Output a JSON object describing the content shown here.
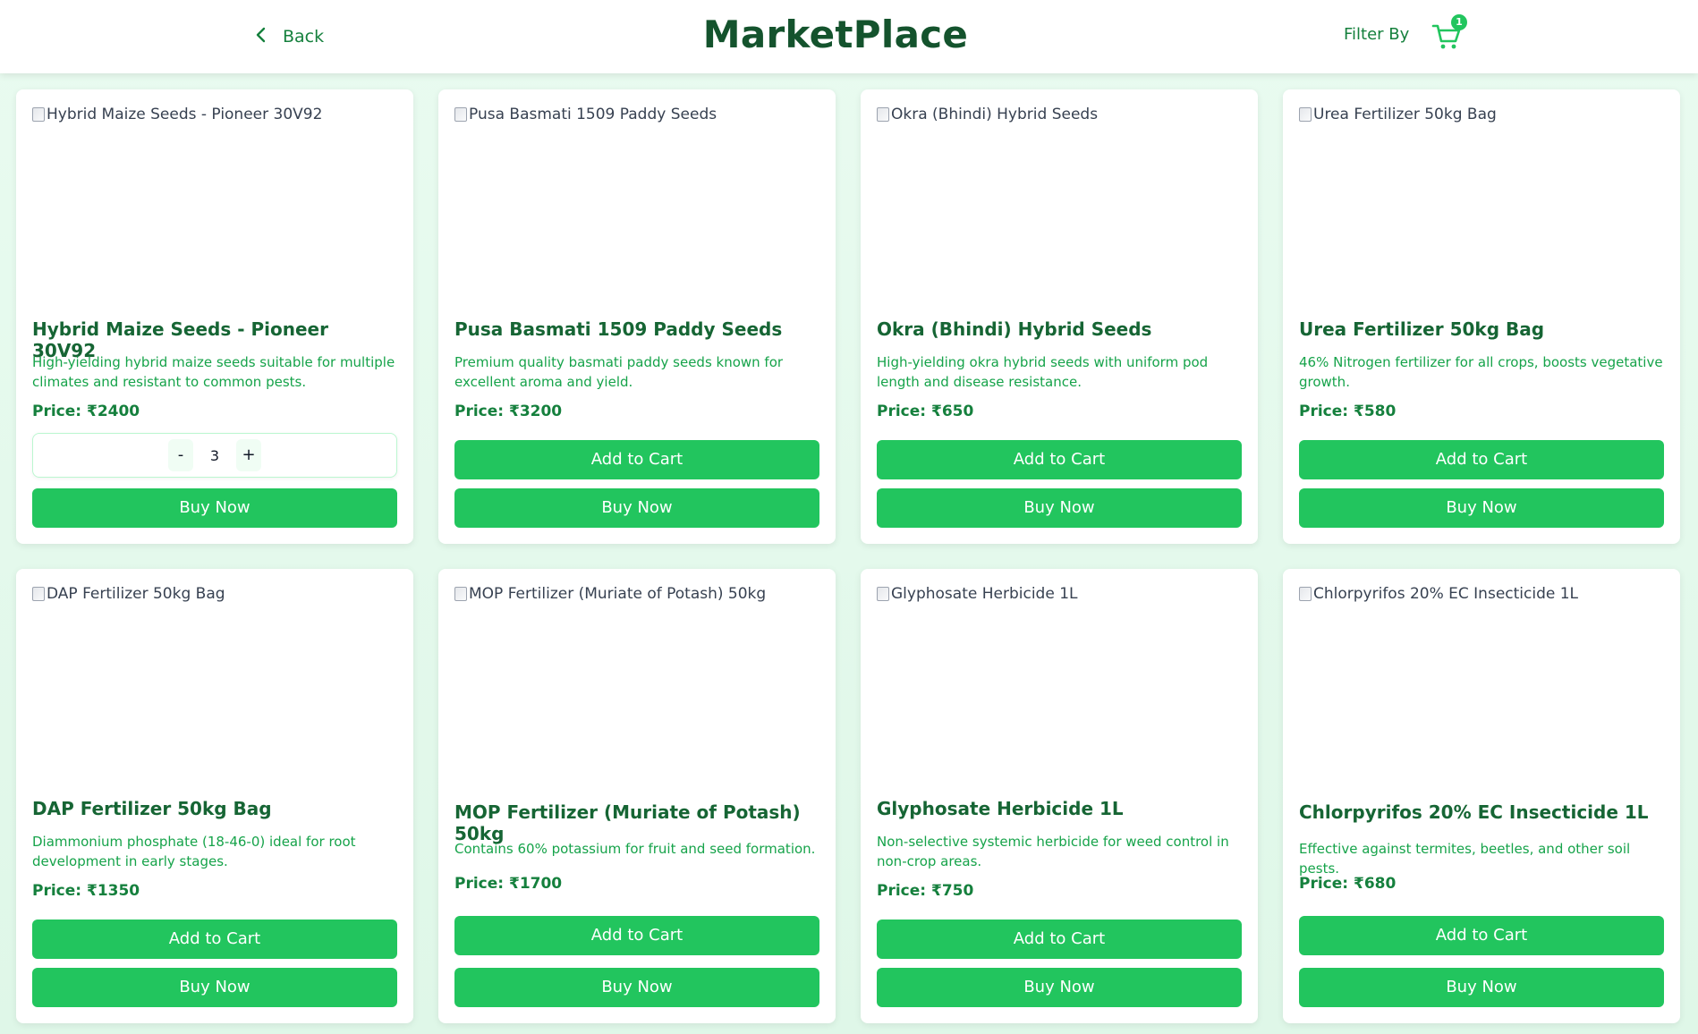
{
  "header": {
    "back_label": "Back",
    "title": "MarketPlace",
    "filter_label": "Filter By",
    "cart_count": "1"
  },
  "colors": {
    "accent": "#22c55e",
    "title": "#14532d",
    "text_green": "#16a34a"
  },
  "products": [
    {
      "image_alt": "Hybrid Maize Seeds - Pioneer 30V92",
      "name": "Hybrid Maize Seeds - Pioneer 30V92",
      "description": "High-yielding hybrid maize seeds suitable for multiple climates and resistant to common pests.",
      "price": "Price: ₹2400",
      "quantity": "3",
      "minus_label": "-",
      "plus_label": "+",
      "buy_label": "Buy Now"
    },
    {
      "image_alt": "Pusa Basmati 1509 Paddy Seeds",
      "name": "Pusa Basmati 1509 Paddy Seeds",
      "description": "Premium quality basmati paddy seeds known for excellent aroma and yield.",
      "price": "Price: ₹3200",
      "add_label": "Add to Cart",
      "buy_label": "Buy Now"
    },
    {
      "image_alt": "Okra (Bhindi) Hybrid Seeds",
      "name": "Okra (Bhindi) Hybrid Seeds",
      "description": "High-yielding okra hybrid seeds with uniform pod length and disease resistance.",
      "price": "Price: ₹650",
      "add_label": "Add to Cart",
      "buy_label": "Buy Now"
    },
    {
      "image_alt": "Urea Fertilizer 50kg Bag",
      "name": "Urea Fertilizer 50kg Bag",
      "description": "46% Nitrogen fertilizer for all crops, boosts vegetative growth.",
      "price": "Price: ₹580",
      "add_label": "Add to Cart",
      "buy_label": "Buy Now"
    },
    {
      "image_alt": "DAP Fertilizer 50kg Bag",
      "name": "DAP Fertilizer 50kg Bag",
      "description": "Diammonium phosphate (18-46-0) ideal for root development in early stages.",
      "price": "Price: ₹1350",
      "add_label": "Add to Cart",
      "buy_label": "Buy Now"
    },
    {
      "image_alt": "MOP Fertilizer (Muriate of Potash) 50kg",
      "name": "MOP Fertilizer (Muriate of Potash) 50kg",
      "description": "Contains 60% potassium for fruit and seed formation.",
      "price": "Price: ₹1700",
      "add_label": "Add to Cart",
      "buy_label": "Buy Now"
    },
    {
      "image_alt": "Glyphosate Herbicide 1L",
      "name": "Glyphosate Herbicide 1L",
      "description": "Non-selective systemic herbicide for weed control in non-crop areas.",
      "price": "Price: ₹750",
      "add_label": "Add to Cart",
      "buy_label": "Buy Now"
    },
    {
      "image_alt": "Chlorpyrifos 20% EC Insecticide 1L",
      "name": "Chlorpyrifos 20% EC Insecticide 1L",
      "description": "Effective against termites, beetles, and other soil pests.",
      "price": "Price: ₹680",
      "add_label": "Add to Cart",
      "buy_label": "Buy Now"
    }
  ]
}
